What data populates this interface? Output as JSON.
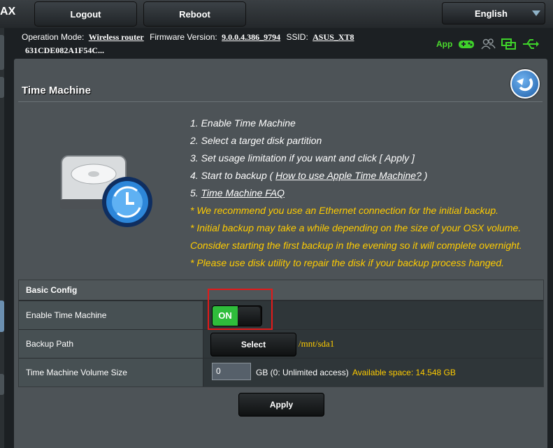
{
  "header": {
    "brand": "AX",
    "logout_label": "Logout",
    "reboot_label": "Reboot",
    "language": "English"
  },
  "info": {
    "operation_mode_label": "Operation Mode:",
    "operation_mode_value": "Wireless router",
    "firmware_label": "Firmware Version:",
    "firmware_value": "9.0.0.4.386_9794",
    "ssid_label": "SSID:",
    "ssid_value": "ASUS_XT8",
    "ssid_line2": "631CDE082A1F54C...",
    "app_label": "App"
  },
  "page": {
    "title": "Time Machine",
    "steps": {
      "s1": "1. Enable Time Machine",
      "s2": "2. Select a target disk partition",
      "s3": "3. Set usage limitation if you want and click [ Apply ]",
      "s4_prefix": "4. Start to backup ( ",
      "s4_link": "How to use Apple Time Machine?",
      "s4_suffix": " )",
      "s5_prefix": "5. ",
      "s5_link": "Time Machine FAQ"
    },
    "notes": {
      "n1": "* We recommend you use an Ethernet connection for the initial backup.",
      "n2": "* Initial backup may take a while depending on the size of your OSX volume.",
      "n3": "Consider starting the first backup in the evening so it will complete overnight.",
      "n4": "* Please use disk utility to repair the disk if your backup process hanged."
    }
  },
  "config": {
    "header": "Basic Config",
    "enable_label": "Enable Time Machine",
    "toggle_state": "ON",
    "backup_path_label": "Backup Path",
    "select_label": "Select",
    "backup_path_value": "/mnt/sda1",
    "volume_size_label": "Time Machine Volume Size",
    "volume_size_value": "0",
    "volume_size_unit": "GB (0: Unlimited access)",
    "available_space": "Available space: 14.548 GB"
  },
  "apply_label": "Apply",
  "colors": {
    "accent_green": "#2fbd3b",
    "note_yellow": "#ffcc00",
    "highlight_red": "#e21a1a"
  }
}
